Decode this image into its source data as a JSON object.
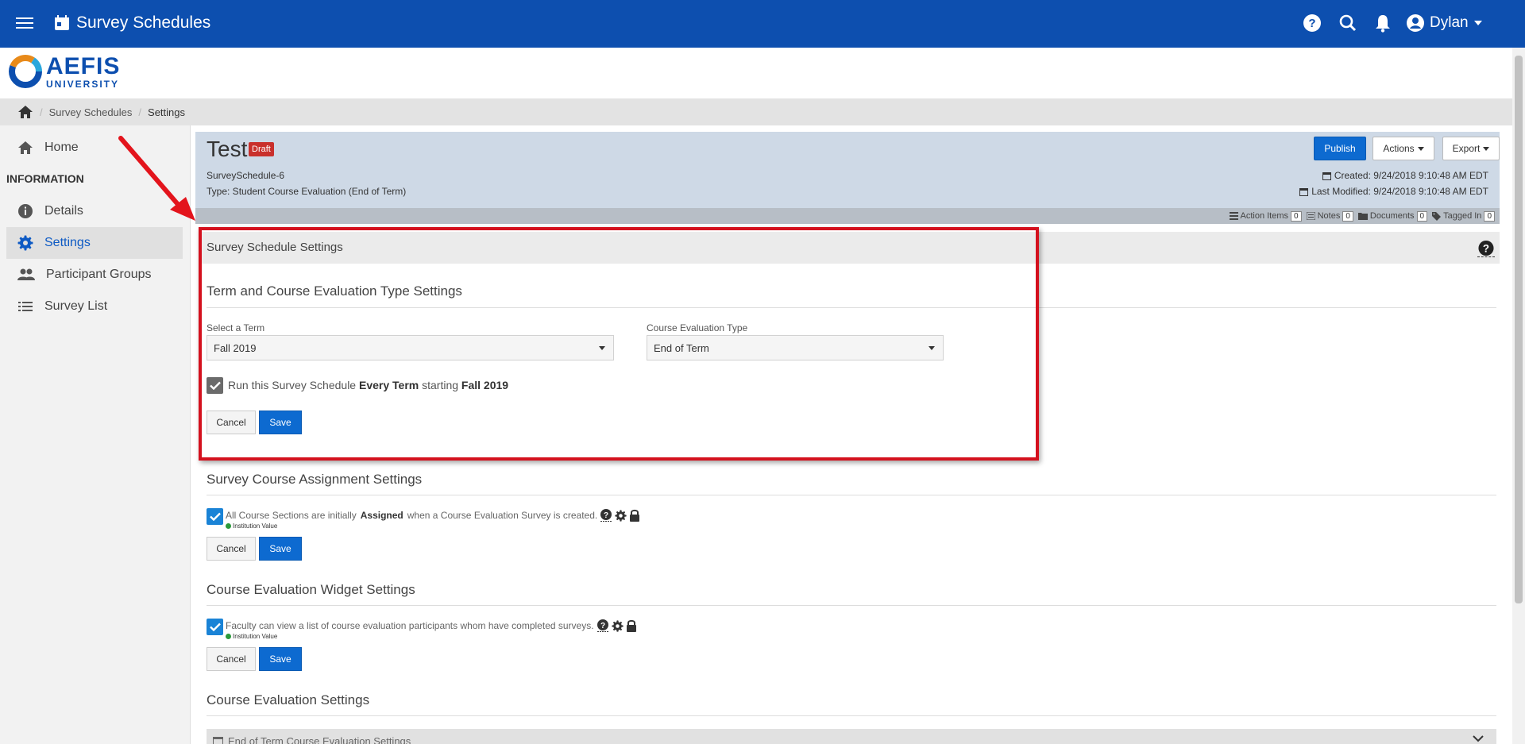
{
  "topbar": {
    "title": "Survey Schedules",
    "user_name": "Dylan"
  },
  "logo": {
    "line1": "AEFIS",
    "line2": "UNIVERSITY"
  },
  "breadcrumb": {
    "items": [
      "Survey Schedules",
      "Settings"
    ]
  },
  "sidebar": {
    "home": "Home",
    "section": "INFORMATION",
    "items": [
      {
        "label": "Details"
      },
      {
        "label": "Settings"
      },
      {
        "label": "Participant Groups"
      },
      {
        "label": "Survey List"
      }
    ]
  },
  "header": {
    "title": "Test",
    "badge": "Draft",
    "id": "SurveySchedule-6",
    "type": "Type: Student Course Evaluation (End of Term)",
    "publish": "Publish",
    "actions": "Actions",
    "export": "Export",
    "created": "Created: 9/24/2018 9:10:48 AM EDT",
    "modified": "Last Modified: 9/24/2018 9:10:48 AM EDT"
  },
  "meta": {
    "action_items": "Action Items",
    "action_items_count": "0",
    "notes": "Notes",
    "notes_count": "0",
    "documents": "Documents",
    "documents_count": "0",
    "tagged_in": "Tagged In",
    "tagged_in_count": "0"
  },
  "settings": {
    "header": "Survey Schedule Settings",
    "term_section": {
      "title": "Term and Course Evaluation Type Settings",
      "term_label": "Select a Term",
      "term_value": "Fall 2019",
      "type_label": "Course Evaluation Type",
      "type_value": "End of Term",
      "run_prefix": "Run this Survey Schedule",
      "run_every": "Every Term",
      "run_mid": "starting",
      "run_term": "Fall 2019",
      "cancel": "Cancel",
      "save": "Save"
    },
    "assignment_section": {
      "title": "Survey Course Assignment Settings",
      "text_prefix": "All Course Sections are initially",
      "text_bold": "Assigned",
      "text_suffix": "when a Course Evaluation Survey is created.",
      "institution_value": "Institution Value",
      "cancel": "Cancel",
      "save": "Save"
    },
    "widget_section": {
      "title": "Course Evaluation Widget Settings",
      "text": "Faculty can view a list of course evaluation participants whom have completed surveys.",
      "institution_value": "Institution Value",
      "cancel": "Cancel",
      "save": "Save"
    },
    "course_eval_section": {
      "title": "Course Evaluation Settings",
      "collapsed_label": "End of Term Course Evaluation Settings"
    }
  },
  "colors": {
    "primary": "#0d4faf",
    "button": "#0d6ad0",
    "highlight": "#d4111e",
    "draft": "#c9302c"
  }
}
